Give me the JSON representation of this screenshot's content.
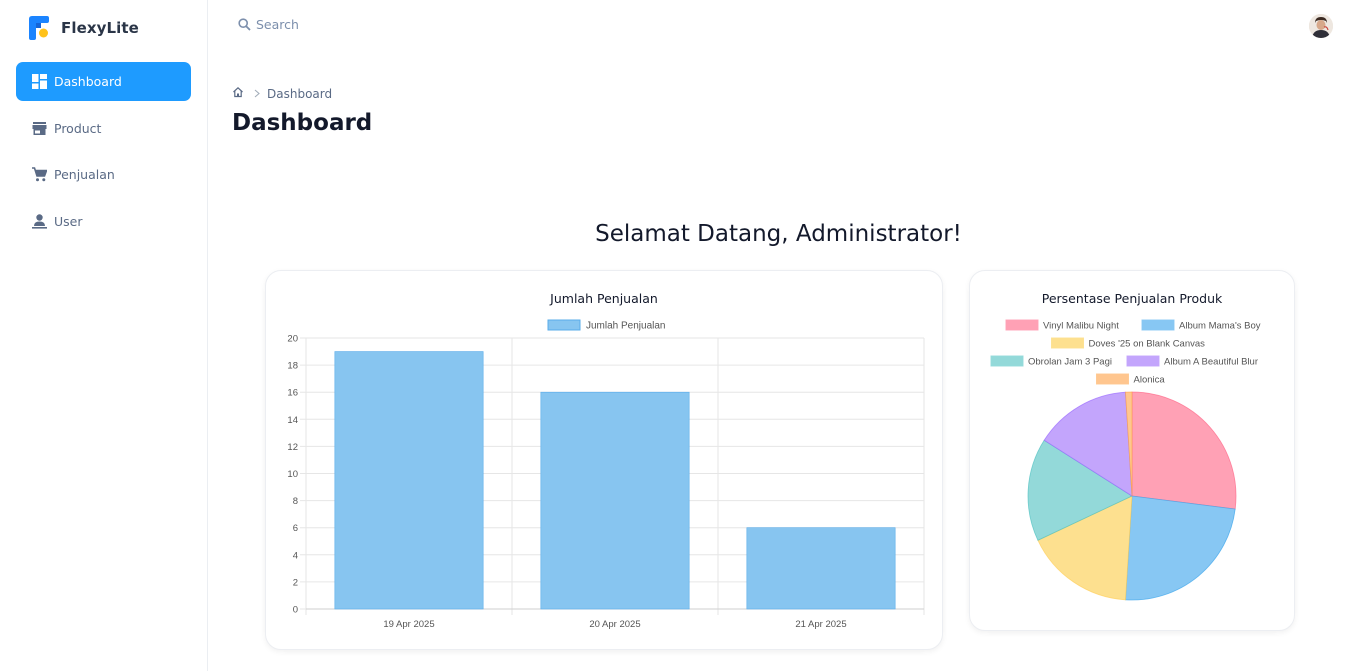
{
  "app": {
    "name": "FlexyLite"
  },
  "sidebar": {
    "items": [
      {
        "label": "Dashboard",
        "icon": "dashboard-icon",
        "active": true
      },
      {
        "label": "Product",
        "icon": "store-icon",
        "active": false
      },
      {
        "label": "Penjualan",
        "icon": "cart-icon",
        "active": false
      },
      {
        "label": "User",
        "icon": "user-icon",
        "active": false
      }
    ]
  },
  "topbar": {
    "search_placeholder": "Search"
  },
  "breadcrumb": {
    "current": "Dashboard"
  },
  "page": {
    "title": "Dashboard",
    "welcome": "Selamat Datang, Administrator!"
  },
  "colors": {
    "accent": "#1e9bff",
    "bar": "#87c5f0",
    "bar_border": "#5aacea"
  },
  "chart_data": [
    {
      "type": "bar",
      "title": "Jumlah Penjualan",
      "categories": [
        "19 Apr 2025",
        "20 Apr 2025",
        "21 Apr 2025"
      ],
      "series": [
        {
          "name": "Jumlah Penjualan",
          "values": [
            19,
            16,
            6
          ]
        }
      ],
      "ylim": [
        0,
        20
      ],
      "yticks": [
        0,
        2,
        4,
        6,
        8,
        10,
        12,
        14,
        16,
        18,
        20
      ],
      "grid": true,
      "legend": "top"
    },
    {
      "type": "pie",
      "title": "Persentase Penjualan Produk",
      "labels": [
        "Vinyl Malibu Night",
        "Album Mama's Boy",
        "Doves '25 on Blank Canvas",
        "Obrolan Jam 3 Pagi",
        "Album A Beautiful Blur",
        "Alonica"
      ],
      "values": [
        27,
        24,
        17,
        16,
        15,
        1
      ],
      "colors": [
        "#ffa1b5",
        "#87c7f3",
        "#fde08f",
        "#93d9d9",
        "#c3a5fc",
        "#ffc68f"
      ],
      "legend": "top"
    }
  ]
}
